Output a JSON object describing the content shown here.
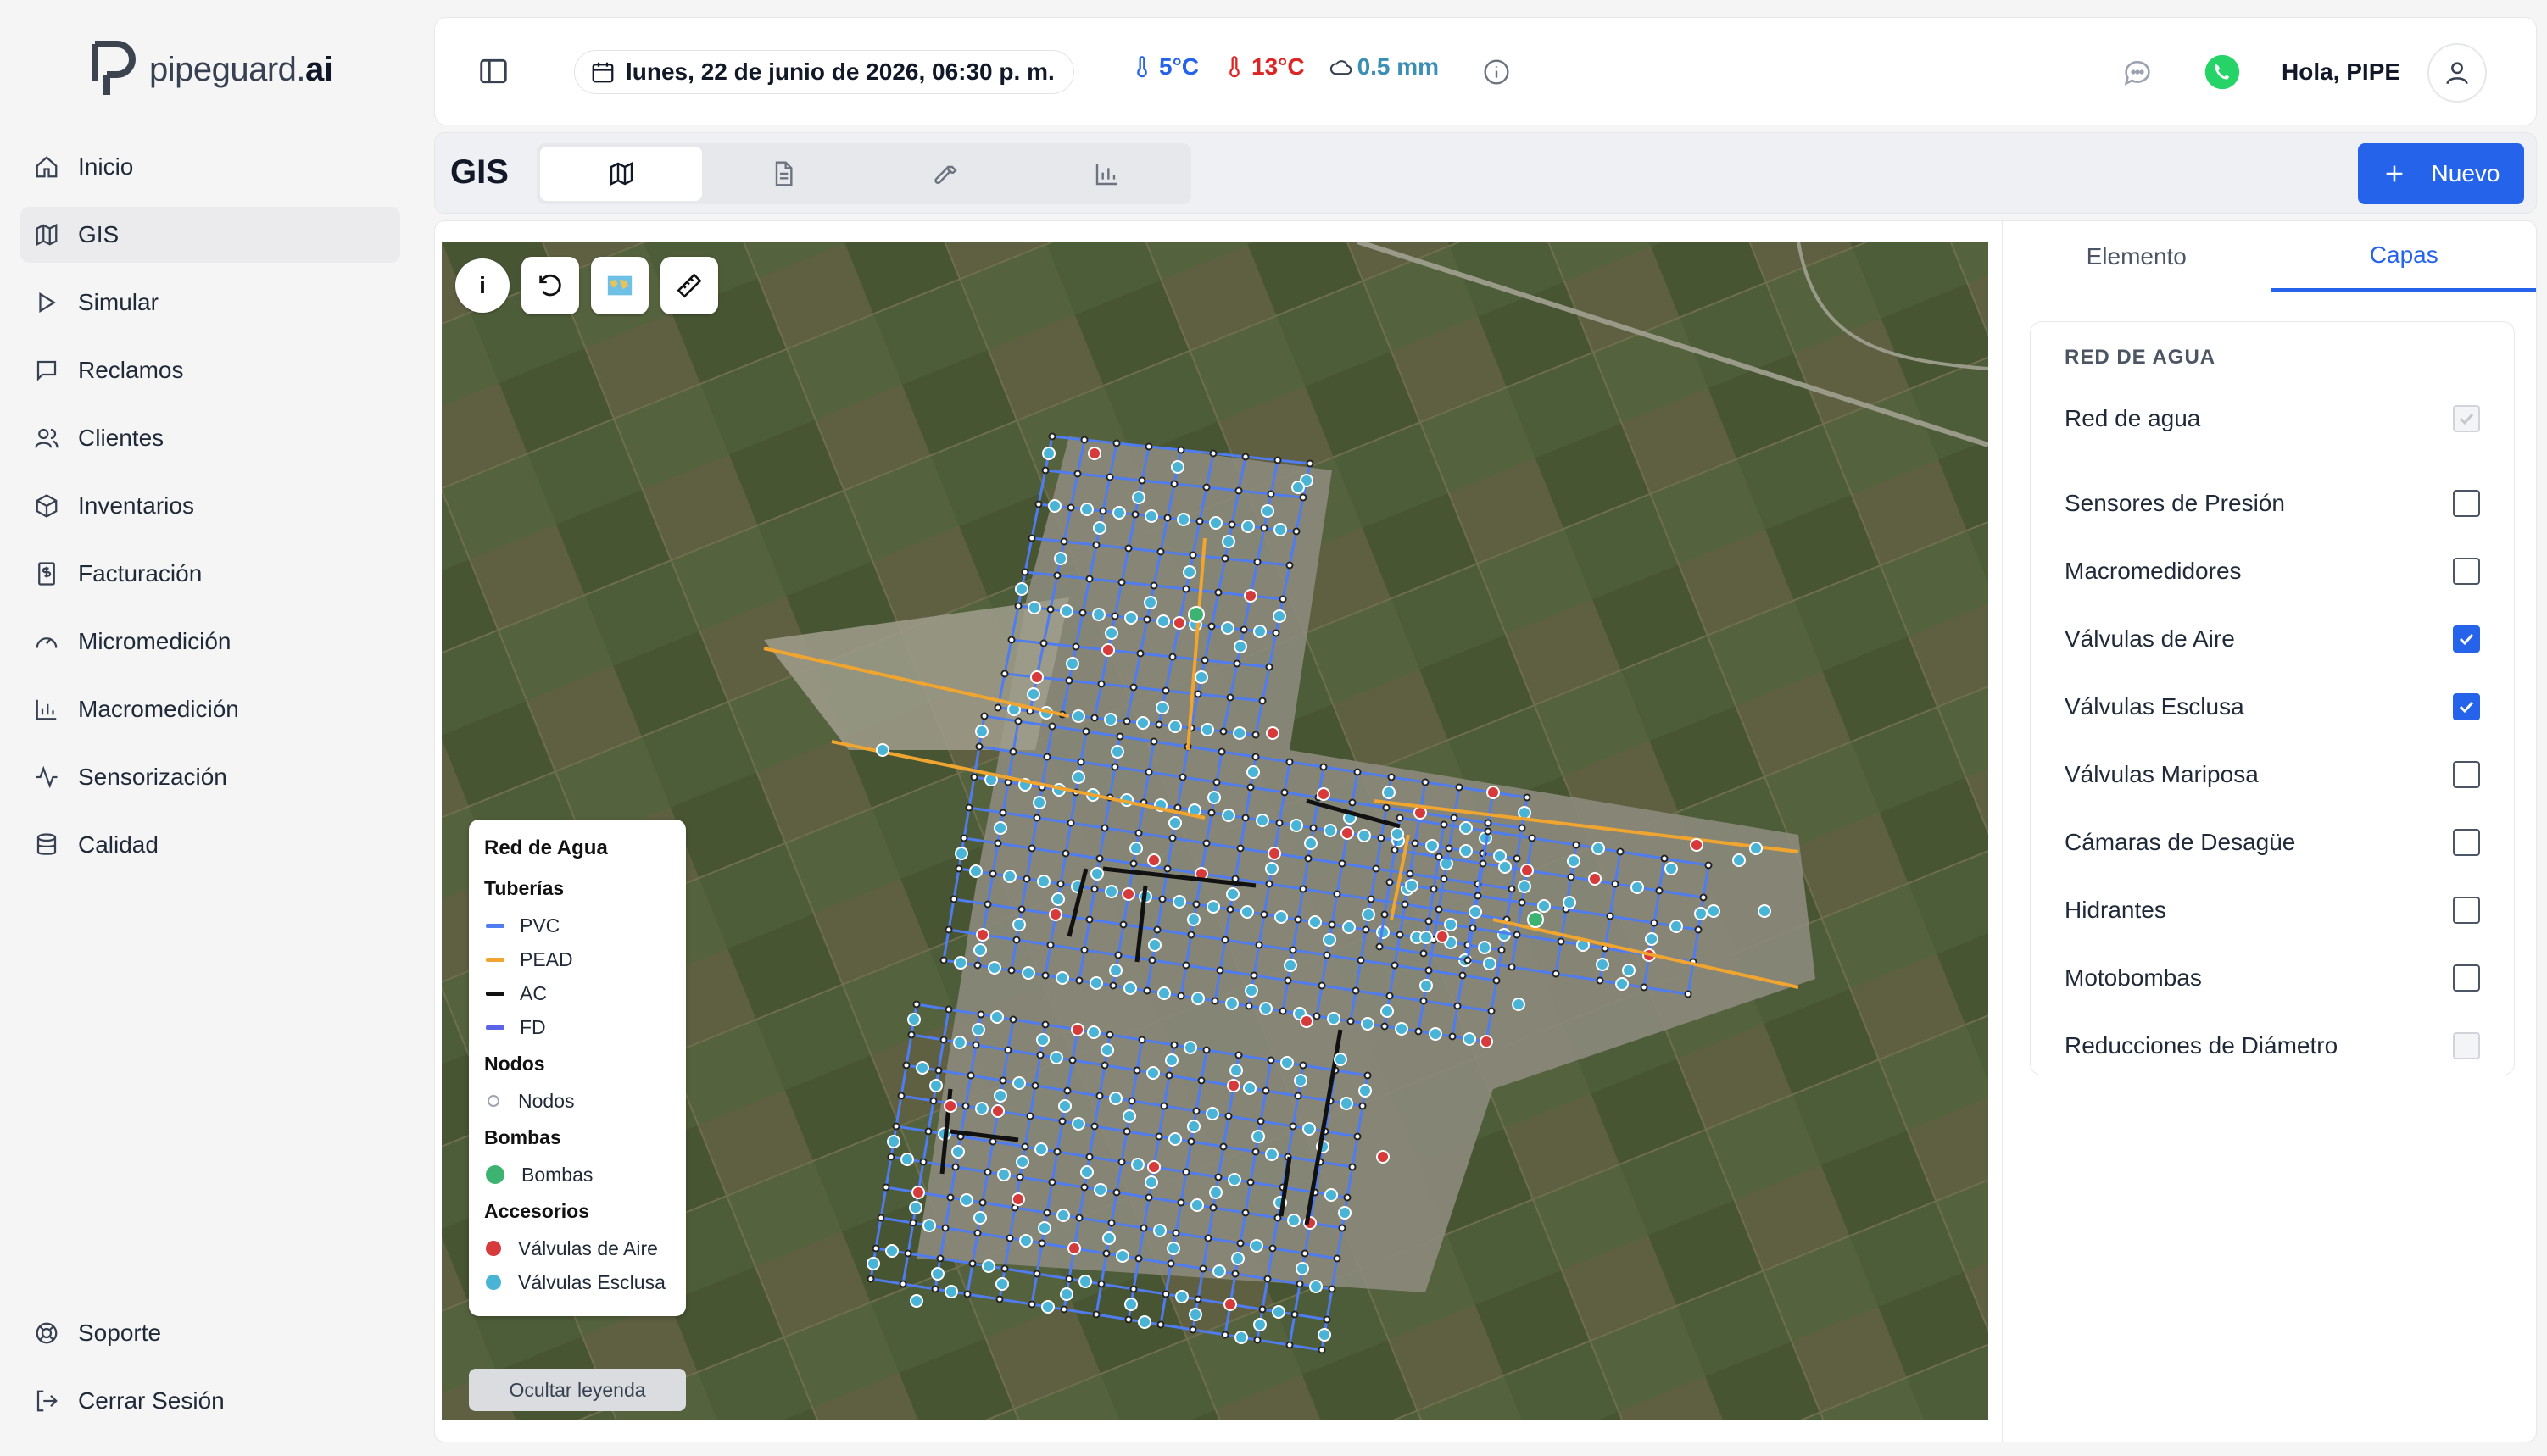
{
  "brand": {
    "name_light": "pipeguard.",
    "name_bold": "ai"
  },
  "sidebar": {
    "items": [
      {
        "label": "Inicio"
      },
      {
        "label": "GIS"
      },
      {
        "label": "Simular"
      },
      {
        "label": "Reclamos"
      },
      {
        "label": "Clientes"
      },
      {
        "label": "Inventarios"
      },
      {
        "label": "Facturación"
      },
      {
        "label": "Micromedición"
      },
      {
        "label": "Macromedición"
      },
      {
        "label": "Sensorización"
      },
      {
        "label": "Calidad"
      }
    ],
    "bottom": [
      {
        "label": "Soporte"
      },
      {
        "label": "Cerrar Sesión"
      }
    ],
    "active": "GIS"
  },
  "topbar": {
    "date": "lunes, 22 de junio de 2026, 06:30 p. m.",
    "temp_min": "5°C",
    "temp_max": "13°C",
    "rain": "0.5 mm",
    "greeting": "Hola, PIPE"
  },
  "gis": {
    "title": "GIS",
    "tabs": [
      {
        "icon": "map-icon",
        "active": true
      },
      {
        "icon": "document-icon",
        "active": false
      },
      {
        "icon": "wrench-icon",
        "active": false
      },
      {
        "icon": "bar-chart-icon",
        "active": false
      }
    ],
    "new_label": "Nuevo"
  },
  "map": {
    "tools": [
      "i"
    ],
    "legend": {
      "title": "Red de Agua",
      "pipes_title": "Tuberías",
      "pipes": [
        {
          "label": "PVC",
          "color": "#4f7cf0"
        },
        {
          "label": "PEAD",
          "color": "#f0a531"
        },
        {
          "label": "AC",
          "color": "#111111"
        },
        {
          "label": "FD",
          "color": "#5b63e6"
        }
      ],
      "nodes_title": "Nodos",
      "nodes_label": "Nodos",
      "pumps_title": "Bombas",
      "pumps_label": "Bombas",
      "pump_color": "#3cb371",
      "accessories_title": "Accesorios",
      "accessories": [
        {
          "label": "Válvulas de Aire",
          "color": "#d63a3a"
        },
        {
          "label": "Válvulas Esclusa",
          "color": "#49b4d6"
        }
      ]
    },
    "hide_legend": "Ocultar leyenda"
  },
  "right_panel": {
    "tabs": [
      {
        "label": "Elemento",
        "active": false
      },
      {
        "label": "Capas",
        "active": true
      }
    ],
    "section_title": "RED DE AGUA",
    "layers": [
      {
        "label": "Red de agua",
        "state": "checked-disabled"
      },
      {
        "label": "Sensores de Presión",
        "state": "unchecked"
      },
      {
        "label": "Macromedidores",
        "state": "unchecked"
      },
      {
        "label": "Válvulas de Aire",
        "state": "checked"
      },
      {
        "label": "Válvulas Esclusa",
        "state": "checked"
      },
      {
        "label": "Válvulas Mariposa",
        "state": "unchecked"
      },
      {
        "label": "Cámaras de Desagüe",
        "state": "unchecked"
      },
      {
        "label": "Hidrantes",
        "state": "unchecked"
      },
      {
        "label": "Motobombas",
        "state": "unchecked"
      },
      {
        "label": "Reducciones de Diámetro",
        "state": "disabled"
      }
    ]
  },
  "colors": {
    "accent": "#2563eb",
    "whatsapp": "#25d366"
  }
}
